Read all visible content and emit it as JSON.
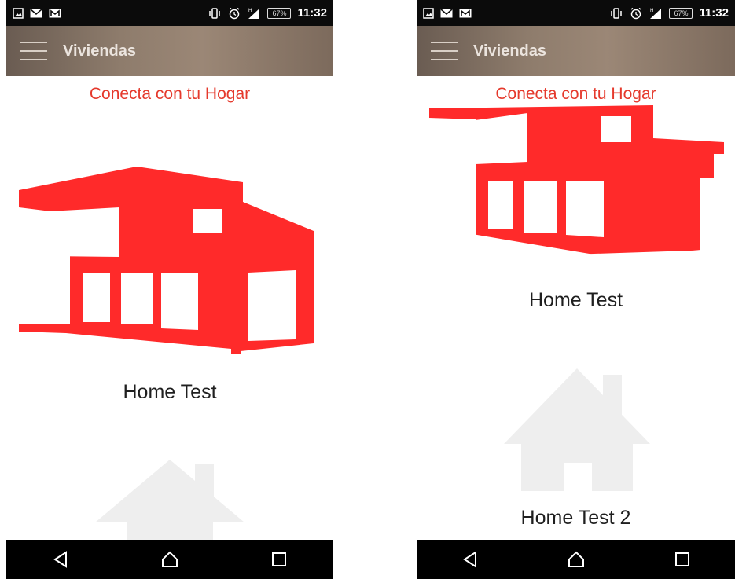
{
  "left": {
    "status": {
      "time": "11:32",
      "battery": "67%"
    },
    "app_bar": {
      "title": "Viviendas"
    },
    "subtitle": "Conecta con tu Hogar",
    "homes": [
      {
        "name": "Home Test"
      }
    ]
  },
  "right": {
    "status": {
      "time": "11:32",
      "battery": "67%"
    },
    "app_bar": {
      "title": "Viviendas"
    },
    "subtitle": "Conecta con tu Hogar",
    "homes": [
      {
        "name": "Home Test"
      },
      {
        "name": "Home Test 2"
      }
    ]
  },
  "colors": {
    "accent_red": "#ff2a2a",
    "subtitle_red": "#e5392c",
    "placeholder_gray": "#eeeeee",
    "app_bar_brown": "#8e7c6c"
  },
  "icons": {
    "status": [
      "image-icon",
      "email-icon",
      "gmail-icon",
      "vibrate-icon",
      "alarm-icon",
      "signal-icon"
    ],
    "navigation": [
      "back-icon",
      "home-icon",
      "recents-icon"
    ],
    "menu": "hamburger-menu-icon",
    "home_selected": "modern-house-icon",
    "home_default": "house-placeholder-icon"
  }
}
